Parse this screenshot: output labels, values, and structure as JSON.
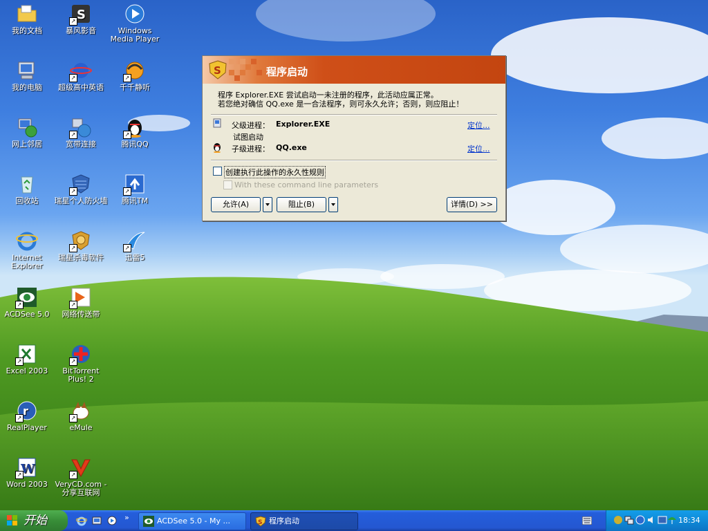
{
  "desktop_icons": [
    {
      "label": "我的文档",
      "icon": "documents-folder-icon"
    },
    {
      "label": "暴风影音",
      "icon": "storm-player-icon"
    },
    {
      "label": "Windows Media Player",
      "icon": "media-player-icon"
    },
    {
      "label": "我的电脑",
      "icon": "my-computer-icon"
    },
    {
      "label": "超级高中英语",
      "icon": "english-software-icon"
    },
    {
      "label": "千千静听",
      "icon": "ttplayer-icon"
    },
    {
      "label": "网上邻居",
      "icon": "network-places-icon"
    },
    {
      "label": "宽带连接",
      "icon": "broadband-icon"
    },
    {
      "label": "腾讯QQ",
      "icon": "qq-penguin-icon"
    },
    {
      "label": "回收站",
      "icon": "recycle-bin-icon"
    },
    {
      "label": "瑞星个人防火墙",
      "icon": "firewall-icon"
    },
    {
      "label": "腾讯TM",
      "icon": "tencent-tm-icon"
    },
    {
      "label": "Internet Explorer",
      "icon": "ie-icon"
    },
    {
      "label": "瑞星杀毒软件",
      "icon": "rising-antivirus-icon"
    },
    {
      "label": "迅雷5",
      "icon": "thunder-icon"
    },
    {
      "label": "ACDSee 5.0",
      "icon": "acdsee-icon"
    },
    {
      "label": "网络传送带",
      "icon": "net-transport-icon"
    },
    {
      "label": "Excel 2003",
      "icon": "excel-icon"
    },
    {
      "label": "BitTorrent Plus! 2",
      "icon": "bittorrent-icon"
    },
    {
      "label": "RealPlayer",
      "icon": "realplayer-icon"
    },
    {
      "label": "eMule",
      "icon": "emule-icon"
    },
    {
      "label": "Word 2003",
      "icon": "word-icon"
    },
    {
      "label": "VeryCD.com - 分享互联网",
      "icon": "verycd-icon"
    }
  ],
  "dialog": {
    "title": "程序启动",
    "message_line1": "程序 Explorer.EXE 尝试启动一未注册的程序，此活动应属正常。",
    "message_line2": "若您绝对确信 QQ.exe 是一合法程序，则可永久允许；否则，则应阻止！",
    "parent_label": "父级进程：",
    "parent_value": "Explorer.EXE",
    "locate_label": "定位...",
    "attempt_label": "试图启动",
    "child_label": "子级进程：",
    "child_value": "QQ.exe",
    "permanent_rule_label": "创建执行此操作的永久性规则",
    "cmdline_label": "With these command line parameters",
    "allow_label": "允许(A)",
    "block_label": "阻止(B)",
    "details_label": "详情(D) >>"
  },
  "taskbar": {
    "start_label": "开始",
    "tasks": [
      {
        "label": "ACDSee 5.0 - My ...",
        "active": false
      },
      {
        "label": "程序启动",
        "active": true
      }
    ],
    "clock": "18:34",
    "colors": {
      "taskbar": "#245edb",
      "start": "#388e38",
      "tray": "#0f8ad8"
    }
  }
}
